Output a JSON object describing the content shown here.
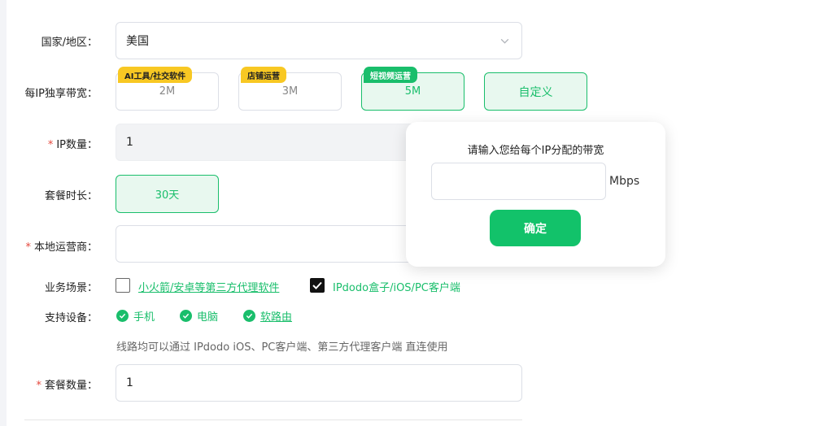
{
  "country": {
    "label": "国家/地区：",
    "value": "美国"
  },
  "bandwidth": {
    "label": "每IP独享带宽：",
    "options": [
      {
        "tag": "AI工具/社交软件",
        "value": "2M"
      },
      {
        "tag": "店铺运营",
        "value": "3M"
      },
      {
        "tag": "短视频运营",
        "value": "5M"
      }
    ],
    "custom_label": "自定义"
  },
  "ip_count": {
    "required_mark": "*",
    "label": "IP数量：",
    "value": "1"
  },
  "duration": {
    "label": "套餐时长：",
    "option": "30天"
  },
  "local_isp": {
    "required_mark": "*",
    "label": "本地运营商：",
    "value": ""
  },
  "scenario": {
    "label": "业务场景：",
    "options": [
      {
        "label": "小火箭/安卓等第三方代理软件",
        "checked": false
      },
      {
        "label": "IPdodo盒子/iOS/PC客户端",
        "checked": true
      }
    ]
  },
  "devices": {
    "label": "支持设备：",
    "items": [
      "手机",
      "电脑",
      "软路由"
    ]
  },
  "hint": "线路均可以通过 IPdodo iOS、PC客户端、第三方代理客户端 直连使用",
  "package_count": {
    "required_mark": "*",
    "label": "套餐数量：",
    "value": "1"
  },
  "popover": {
    "title": "请输入您给每个IP分配的带宽",
    "input_value": "",
    "unit": "Mbps",
    "confirm_label": "确定"
  },
  "colors": {
    "accent": "#19be6b",
    "tag_yellow": "#f8c823",
    "required": "#e5483d"
  },
  "icons": {
    "select": "chevron-down-icon",
    "device": "check-circle-icon",
    "checkbox": "checkmark-icon"
  }
}
